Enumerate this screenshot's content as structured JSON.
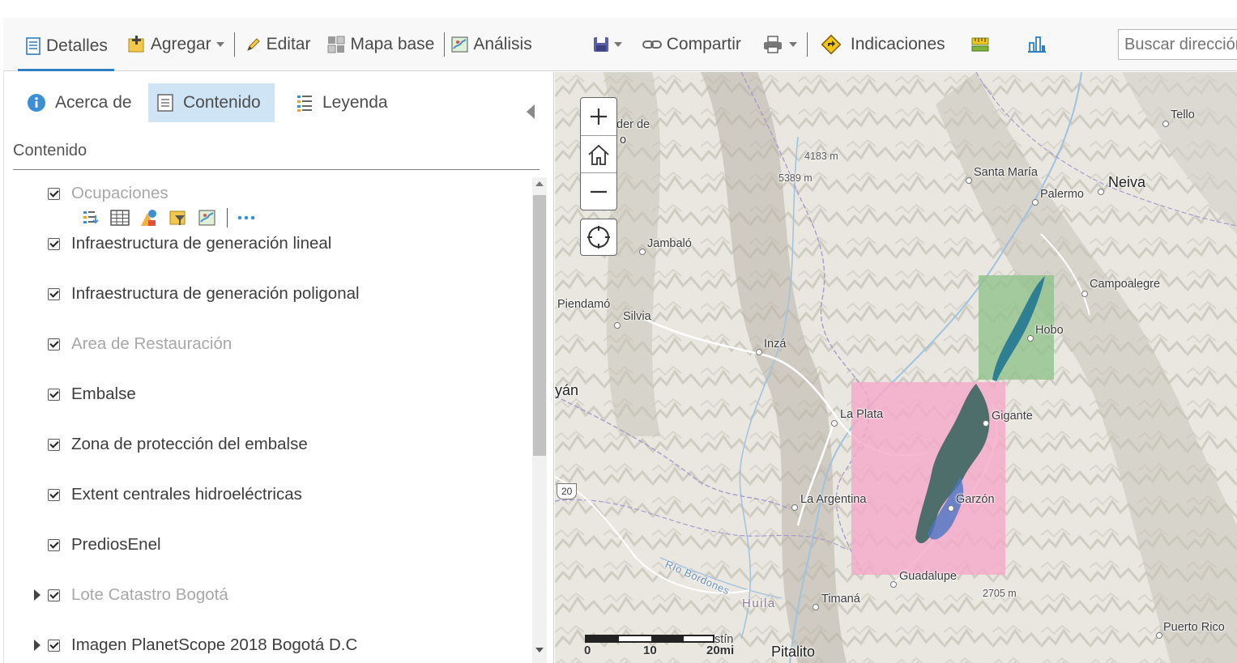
{
  "toolbar": {
    "details": "Detalles",
    "add": "Agregar",
    "edit": "Editar",
    "basemap": "Mapa base",
    "analysis": "Análisis",
    "share": "Compartir",
    "directions": "Indicaciones",
    "search_placeholder": "Buscar dirección"
  },
  "panel": {
    "tabs": [
      "Acerca de",
      "Contenido",
      "Leyenda"
    ],
    "active_tab": "Contenido",
    "section_title": "Contenido",
    "layers": [
      {
        "label": "Ocupaciones",
        "checked": true,
        "dimmed": true,
        "expandable": false
      },
      {
        "label": "Infraestructura de generación lineal",
        "checked": true,
        "dimmed": false,
        "expandable": false
      },
      {
        "label": "Infraestructura de generación poligonal",
        "checked": true,
        "dimmed": false,
        "expandable": false
      },
      {
        "label": "Area de Restauración",
        "checked": true,
        "dimmed": true,
        "expandable": false
      },
      {
        "label": "Embalse",
        "checked": true,
        "dimmed": false,
        "expandable": false
      },
      {
        "label": "Zona de protección del embalse",
        "checked": true,
        "dimmed": false,
        "expandable": false
      },
      {
        "label": "Extent centrales hidroeléctricas",
        "checked": true,
        "dimmed": false,
        "expandable": false
      },
      {
        "label": "PrediosEnel",
        "checked": true,
        "dimmed": false,
        "expandable": false
      },
      {
        "label": "Lote Catastro Bogotá",
        "checked": true,
        "dimmed": true,
        "expandable": true
      },
      {
        "label": "Imagen PlanetScope 2018 Bogotá D.C",
        "checked": true,
        "dimmed": false,
        "expandable": true
      }
    ],
    "layer_tools": [
      "legend-list-icon",
      "table-icon",
      "symbology-icon",
      "filter-icon",
      "analysis-icon",
      "more-icon"
    ]
  },
  "map": {
    "places": {
      "tello": "Tello",
      "saladero": "der de",
      "saladero2": "o",
      "elev_4183": "4183 m",
      "elev_5389": "5389 m",
      "santa_maria": "Santa María",
      "neiva": "Neiva",
      "palermo": "Palermo",
      "jambalo": "Jambaló",
      "campoalegre": "Campoalegre",
      "piendamo": "Piendamó",
      "silvia": "Silvia",
      "hobo": "Hobo",
      "inza": "Inzá",
      "popayan": "yán",
      "la_plata": "La Plata",
      "gigante": "Gigante",
      "route_20": "20",
      "la_argentina": "La Argentina",
      "garzon": "Garzón",
      "rio_bordones": "Río Bordones",
      "guadalupe": "Guadalupe",
      "huila": "Huila",
      "timana": "Timaná",
      "elev_2705": "2705 m",
      "puerto_rico": "Puerto Rico",
      "agustin": "stín",
      "pitalito": "Pitalito"
    },
    "scale": {
      "s0": "0",
      "s10": "10",
      "s20": "20mi"
    },
    "colors": {
      "pink_extent": "#f5a8c8",
      "green_extent": "#8fc28a",
      "reservoir": "#3a7fa0",
      "active_tab_bg": "#cfe4f5",
      "accent": "#2d7fbf"
    }
  }
}
